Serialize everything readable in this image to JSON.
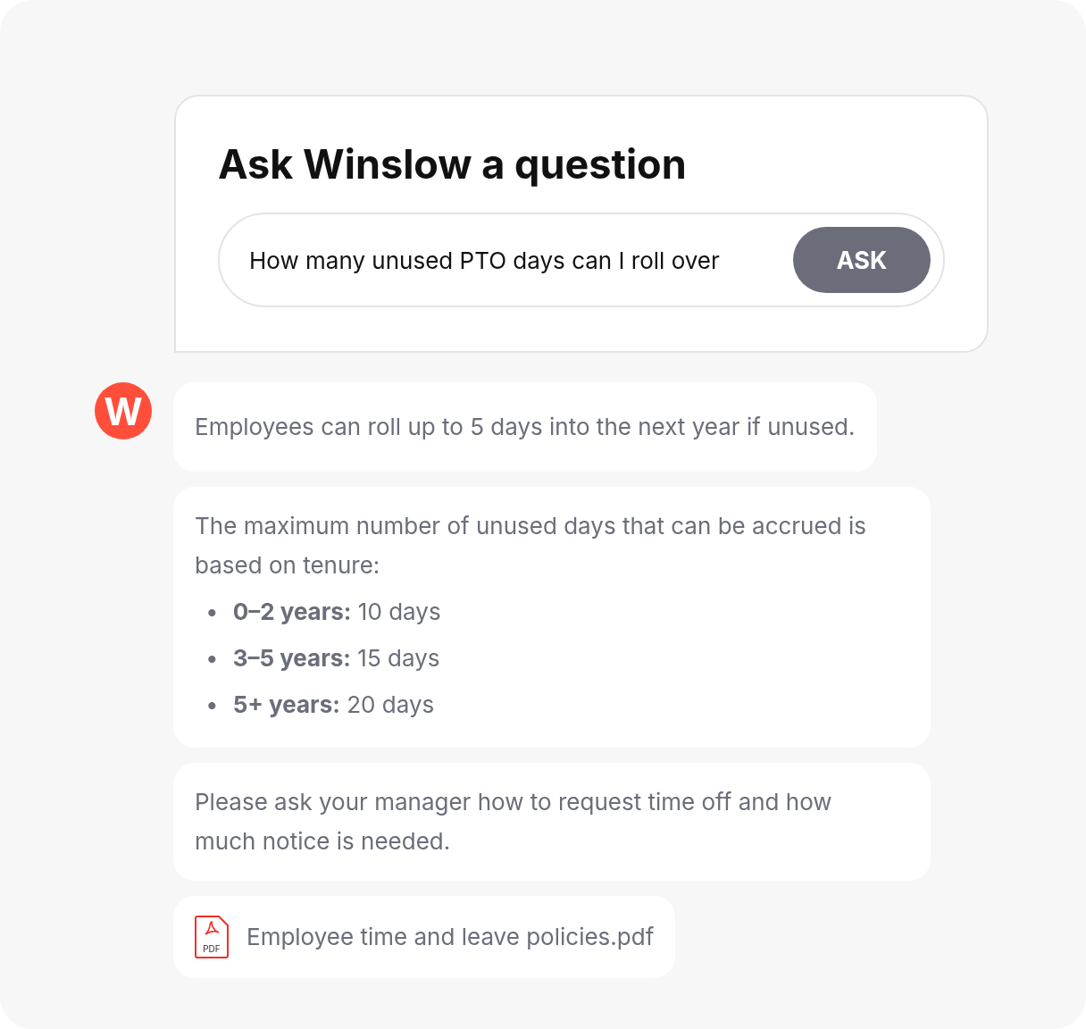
{
  "question_card": {
    "title": "Ask Winslow a question",
    "field": {
      "value": "How many unused PTO days can I roll over"
    },
    "button": "ASK"
  },
  "assistant": {
    "avatar_letter": "W"
  },
  "messages": [
    {
      "kind": "text",
      "text": "Employees can roll up to 5 days into the next year if unused."
    },
    {
      "kind": "list",
      "text": "The maximum number of unused days that can be accrued is based on tenure:",
      "items": [
        {
          "marker": "•",
          "text": "**0–2 years:** 10 days"
        },
        {
          "marker": "•",
          "text": "**3–5 years:** 15 days"
        },
        {
          "marker": "•",
          "text": "**5+ years:** 20 days"
        }
      ]
    },
    {
      "kind": "text",
      "text": "Please ask your manager how to request time off and how much notice is needed."
    },
    {
      "kind": "file",
      "icon_label": "PDF",
      "text": "Employee time and leave policies.pdf"
    }
  ]
}
